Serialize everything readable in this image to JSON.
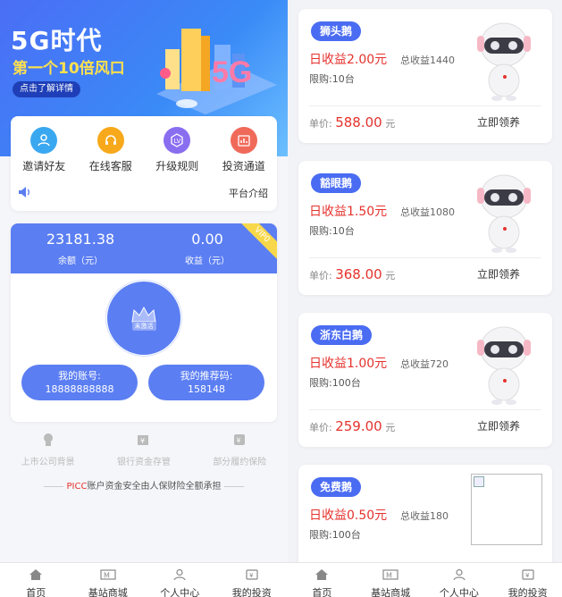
{
  "banner": {
    "title": "5G时代",
    "subtitle": "第一个10倍风口",
    "cta": "点击了解详情"
  },
  "menu": [
    {
      "label": "邀请好友",
      "icon": "invite-user-icon",
      "color": "#3aa8f0"
    },
    {
      "label": "在线客服",
      "icon": "headset-icon",
      "color": "#f7a91b"
    },
    {
      "label": "升级规则",
      "icon": "level-rule-icon",
      "color": "#8a6ef0"
    },
    {
      "label": "投资通道",
      "icon": "invest-channel-icon",
      "color": "#f06a5a"
    }
  ],
  "notice": {
    "text": "平台介绍"
  },
  "account": {
    "balance": "23181.38",
    "balance_label": "余额（元）",
    "income": "0.00",
    "income_label": "收益（元）",
    "vip": "VIP0",
    "status": "未激活",
    "my_account_label": "我的账号:",
    "my_account": "18888888888",
    "referral_label": "我的推荐码:",
    "referral_code": "158148"
  },
  "assurances": [
    {
      "label": "上市公司背景",
      "icon": "listed-company-icon"
    },
    {
      "label": "银行资金存管",
      "icon": "bank-deposit-icon"
    },
    {
      "label": "部分履约保险",
      "icon": "insurance-icon"
    }
  ],
  "picc": {
    "highlight": "PICC",
    "text": "账户资金安全由人保财险全额承担"
  },
  "tabs": [
    {
      "label": "首页",
      "icon": "home-icon"
    },
    {
      "label": "基站商城",
      "icon": "mall-icon"
    },
    {
      "label": "个人中心",
      "icon": "user-icon"
    },
    {
      "label": "我的投资",
      "icon": "investment-icon"
    }
  ],
  "products": [
    {
      "name": "狮头鹅",
      "daily": "日收益2.00元",
      "total": "总收益1440",
      "limit": "限购:10台",
      "price_label": "单价:",
      "price": "588.00",
      "unit": "元",
      "claim": "立即领养"
    },
    {
      "name": "豁眼鹅",
      "daily": "日收益1.50元",
      "total": "总收益1080",
      "limit": "限购:10台",
      "price_label": "单价:",
      "price": "368.00",
      "unit": "元",
      "claim": "立即领养"
    },
    {
      "name": "浙东白鹅",
      "daily": "日收益1.00元",
      "total": "总收益720",
      "limit": "限购:100台",
      "price_label": "单价:",
      "price": "259.00",
      "unit": "元",
      "claim": "立即领养"
    },
    {
      "name": "免费鹅",
      "daily": "日收益0.50元",
      "total": "总收益180",
      "limit": "限购:100台"
    }
  ],
  "colors": {
    "primary": "#5b7ef2",
    "accent_red": "#e5322d",
    "vip_gold": "#f8d84a"
  }
}
